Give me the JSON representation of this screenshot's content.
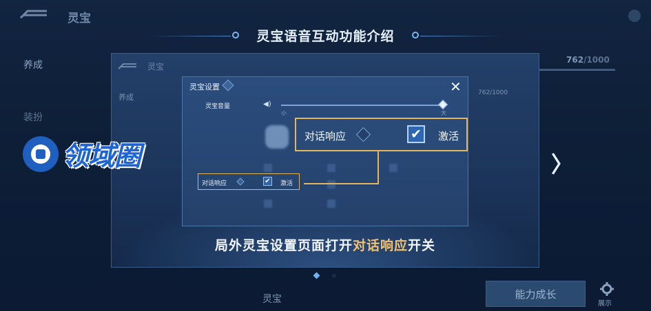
{
  "background": {
    "title": "灵宝",
    "sidebar_top": "养成",
    "sidebar_second": "装扮",
    "progress_current": "762",
    "progress_total": "/1000",
    "growth_button": "能力成长",
    "gear_label": "展示",
    "bottom_label": "灵宝"
  },
  "heading": "灵宝语音互动功能介绍",
  "frame": {
    "inner_title": "灵宝",
    "inner_side": "养成",
    "inner_progress": "762/1000"
  },
  "dialog": {
    "title": "灵宝设置",
    "close_icon": "close-icon",
    "volume_label": "灵宝音量",
    "volume_min": "小",
    "volume_max": "大",
    "volume_level": 1.0,
    "small_option_label": "对话响应",
    "small_option_state": "激活",
    "small_option_checked": true
  },
  "callout": {
    "label": "对话响应",
    "state": "激活",
    "checked": true
  },
  "caption": {
    "prefix": "局外灵宝设置页面打开",
    "highlight": "对话响应",
    "suffix": "开关"
  },
  "watermark": {
    "text": "领域圈"
  },
  "colors": {
    "highlight": "#e7b65c",
    "accent": "#2d66b3"
  },
  "pagination": {
    "current": 1,
    "total": 2
  }
}
